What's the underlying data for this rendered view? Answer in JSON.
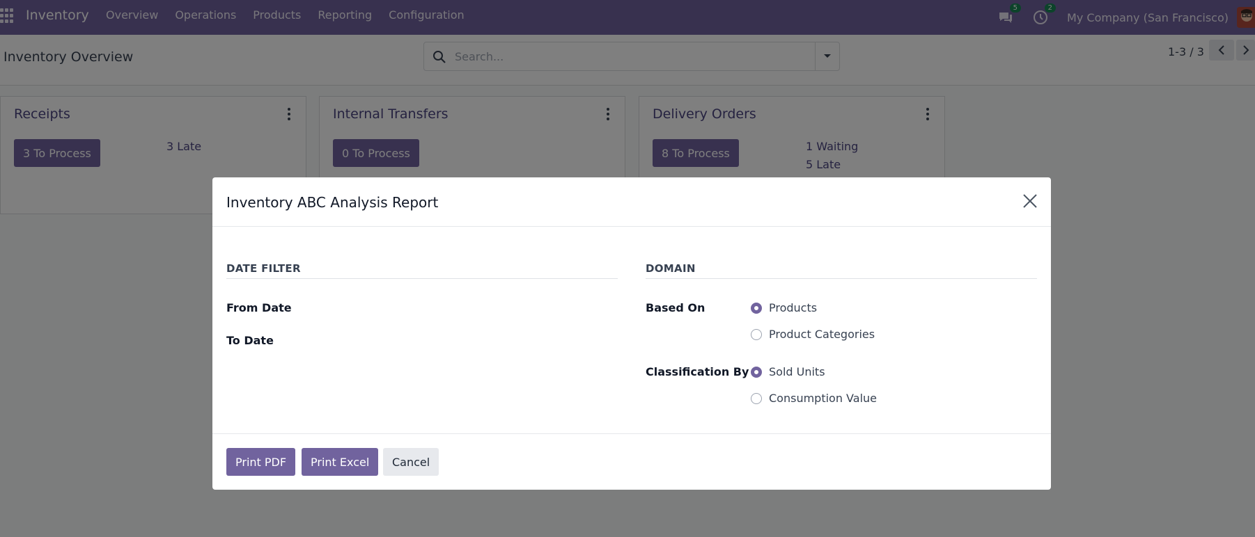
{
  "navbar": {
    "app_name": "Inventory",
    "menu": [
      "Overview",
      "Operations",
      "Products",
      "Reporting",
      "Configuration"
    ],
    "messages_badge": "5",
    "activities_badge": "2",
    "company": "My Company (San Francisco)",
    "bg_color": "#71639e"
  },
  "control_panel": {
    "title": "Inventory Overview",
    "search_placeholder": "Search...",
    "pager": "1-3 / 3"
  },
  "cards": [
    {
      "title": "Receipts",
      "button": "3 To Process",
      "stats": [
        "3 Late"
      ]
    },
    {
      "title": "Internal Transfers",
      "button": "0 To Process",
      "stats": []
    },
    {
      "title": "Delivery Orders",
      "button": "8 To Process",
      "stats": [
        "1 Waiting",
        "5 Late"
      ]
    }
  ],
  "modal": {
    "title": "Inventory ABC Analysis Report",
    "date_filter": {
      "section_title": "DATE FILTER",
      "from_label": "From Date",
      "to_label": "To Date"
    },
    "domain": {
      "section_title": "DOMAIN",
      "based_on_label": "Based On",
      "based_on_options": [
        {
          "label": "Products",
          "checked": true
        },
        {
          "label": "Product Categories",
          "checked": false
        }
      ],
      "classification_label": "Classification By",
      "classification_options": [
        {
          "label": "Sold Units",
          "checked": true
        },
        {
          "label": "Consumption Value",
          "checked": false
        }
      ]
    },
    "buttons": {
      "print_pdf": "Print PDF",
      "print_excel": "Print Excel",
      "cancel": "Cancel"
    }
  },
  "colors": {
    "primary": "#71639e",
    "card_title": "#4b4480"
  }
}
